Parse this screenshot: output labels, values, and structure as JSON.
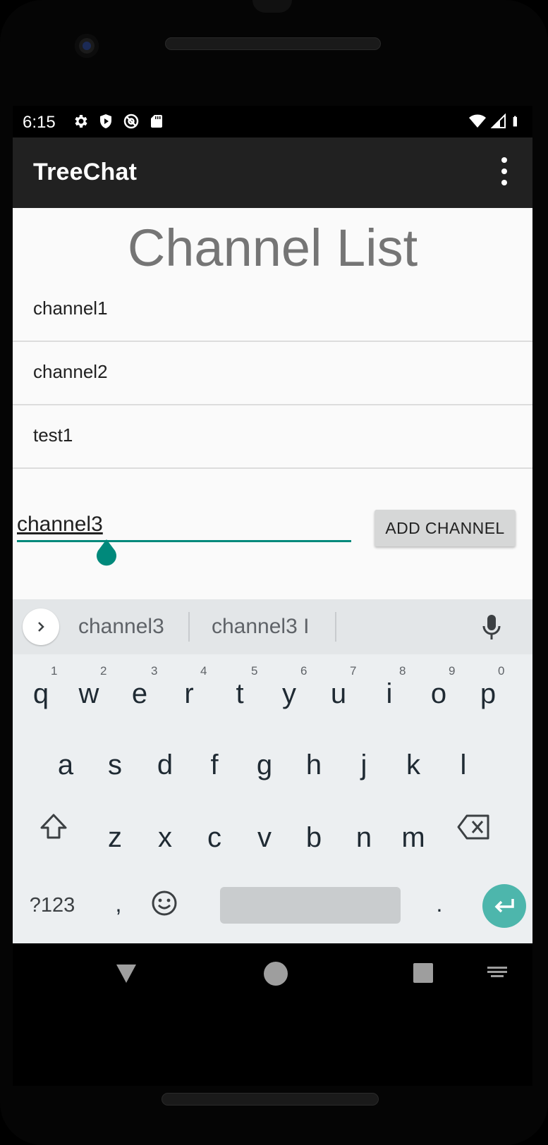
{
  "status_bar": {
    "time": "6:15",
    "left_icons": [
      "settings-icon",
      "shield-play-icon",
      "at-sign-icon",
      "sd-card-icon"
    ],
    "right_icons": [
      "wifi-icon",
      "signal-icon",
      "battery-icon"
    ]
  },
  "app_bar": {
    "title": "TreeChat",
    "menu_icon": "more-vert-icon"
  },
  "page": {
    "title": "Channel List"
  },
  "channels": [
    {
      "label": "channel1"
    },
    {
      "label": "channel2"
    },
    {
      "label": "test1"
    }
  ],
  "input": {
    "value": "channel3",
    "accent_color": "#00897b"
  },
  "add_button": {
    "label": "ADD CHANNEL"
  },
  "keyboard": {
    "suggestions": [
      "channel3",
      "channel3 I"
    ],
    "row1": [
      {
        "key": "q",
        "num": "1"
      },
      {
        "key": "w",
        "num": "2"
      },
      {
        "key": "e",
        "num": "3"
      },
      {
        "key": "r",
        "num": "4"
      },
      {
        "key": "t",
        "num": "5"
      },
      {
        "key": "y",
        "num": "6"
      },
      {
        "key": "u",
        "num": "7"
      },
      {
        "key": "i",
        "num": "8"
      },
      {
        "key": "o",
        "num": "9"
      },
      {
        "key": "p",
        "num": "0"
      }
    ],
    "row2": [
      "a",
      "s",
      "d",
      "f",
      "g",
      "h",
      "j",
      "k",
      "l"
    ],
    "row3": [
      "z",
      "x",
      "c",
      "v",
      "b",
      "n",
      "m"
    ],
    "symbols_key": "?123",
    "comma_key": ",",
    "period_key": ".",
    "enter_color": "#4db6ac"
  },
  "nav_bar": {
    "icons": [
      "back-icon",
      "home-icon",
      "recents-icon",
      "keyboard-switch-icon"
    ]
  }
}
